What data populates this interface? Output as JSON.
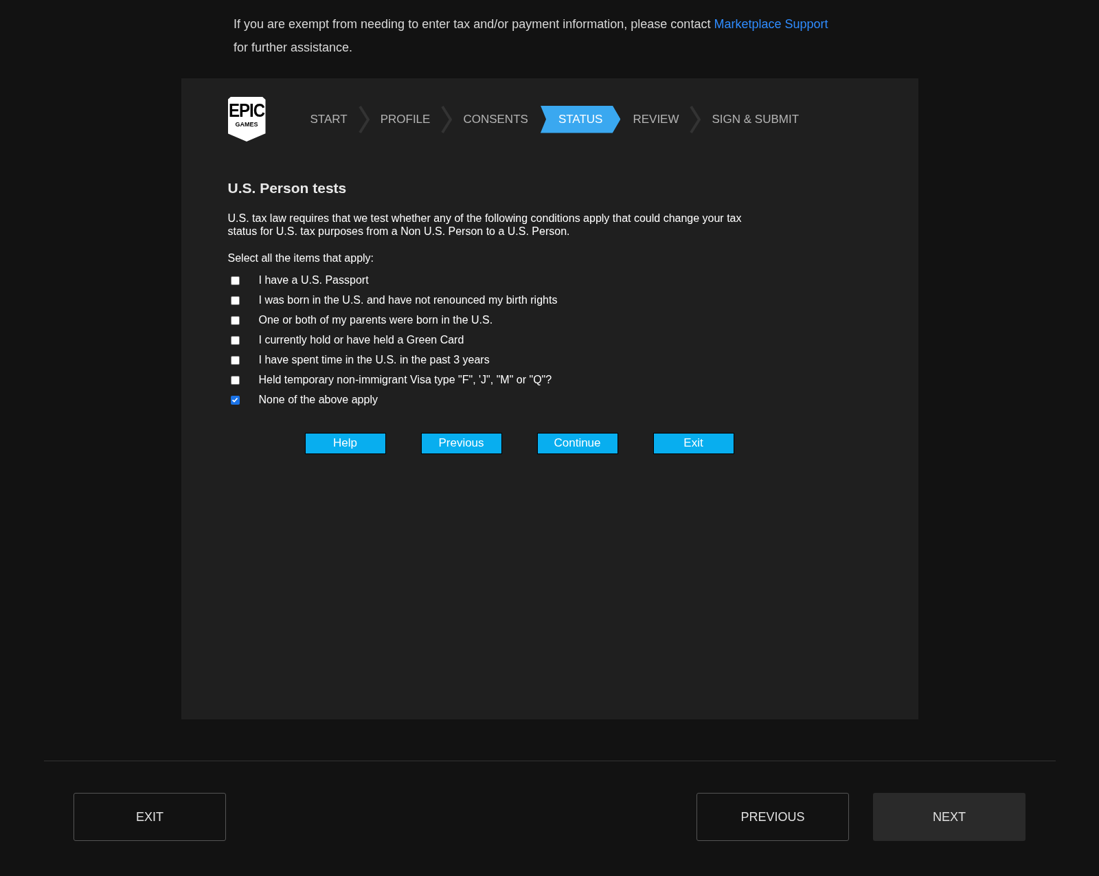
{
  "notice": {
    "before": "If you are exempt from needing to enter tax and/or payment information, please contact ",
    "link": "Marketplace Support",
    "after": " for further assistance."
  },
  "logo": {
    "line_1": "EPIC",
    "line_2": "GAMES"
  },
  "steps": [
    {
      "label": "START",
      "selected": false
    },
    {
      "label": "PROFILE",
      "selected": false
    },
    {
      "label": "CONSENTS",
      "selected": false
    },
    {
      "label": "STATUS",
      "selected": true
    },
    {
      "label": "REVIEW",
      "selected": false
    },
    {
      "label": "SIGN & SUBMIT",
      "selected": false
    }
  ],
  "heading": "U.S. Person tests",
  "description": "U.S. tax law requires that we test whether any of the following conditions apply that could change your tax status for U.S. tax purposes from a Non U.S. Person to a U.S. Person.",
  "prompt": "Select all the items that apply:",
  "options": [
    {
      "label": "I have a U.S. Passport",
      "checked": false
    },
    {
      "label": "I was born in the U.S. and have not renounced my birth rights",
      "checked": false
    },
    {
      "label": "One or both of my parents were born in the U.S.",
      "checked": false
    },
    {
      "label": "I currently hold or have held a Green Card",
      "checked": false
    },
    {
      "label": "I have spent time in the U.S. in the past 3 years",
      "checked": false
    },
    {
      "label": "Held temporary non-immigrant Visa type \"F\", 'J\", \"M\" or \"Q\"?",
      "checked": false
    },
    {
      "label": "None of the above apply",
      "checked": true
    }
  ],
  "form_buttons": [
    "Help",
    "Previous",
    "Continue",
    "Exit"
  ],
  "footer": {
    "exit": "EXIT",
    "previous": "PREVIOUS",
    "next": "NEXT"
  }
}
